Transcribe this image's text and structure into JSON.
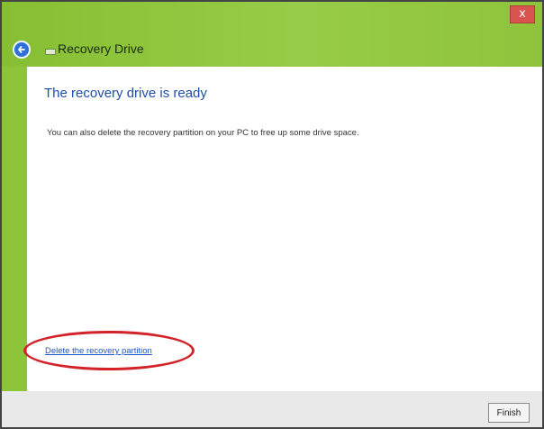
{
  "window": {
    "title": "Recovery Drive",
    "close_label": "x",
    "colors": {
      "titlebar": "#8cc43a",
      "heading": "#1f4fa8",
      "link": "#1d56c7",
      "highlight": "#d2232a"
    }
  },
  "icons": {
    "back": "back-arrow-icon",
    "drive": "drive-icon",
    "close": "close-icon"
  },
  "main": {
    "heading": "The recovery drive is ready",
    "description": "You can also delete the recovery partition on your PC to free up some drive space.",
    "delete_link": "Delete the recovery partition"
  },
  "footer": {
    "finish_label": "Finish"
  }
}
